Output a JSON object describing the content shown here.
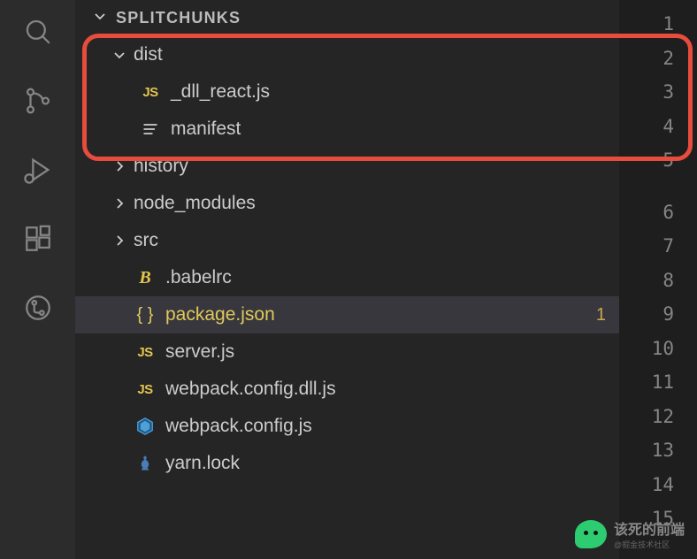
{
  "explorer": {
    "title": "SPLITCHUNKS"
  },
  "tree": {
    "dist": {
      "label": "dist",
      "expanded": true
    },
    "dll_react": {
      "label": "_dll_react.js"
    },
    "manifest": {
      "label": "manifest"
    },
    "history": {
      "label": "history"
    },
    "node_modules": {
      "label": "node_modules"
    },
    "src": {
      "label": "src"
    },
    "babelrc": {
      "label": ".babelrc"
    },
    "package_json": {
      "label": "package.json",
      "badge": "1"
    },
    "server_js": {
      "label": "server.js"
    },
    "webpack_dll": {
      "label": "webpack.config.dll.js"
    },
    "webpack_config": {
      "label": "webpack.config.js"
    },
    "yarn_lock": {
      "label": "yarn.lock"
    }
  },
  "line_numbers": [
    "1",
    "2",
    "3",
    "4",
    "5",
    "6",
    "7",
    "8",
    "9",
    "10",
    "11",
    "12",
    "13",
    "14",
    "15"
  ],
  "watermark": {
    "main": "该死的前端",
    "sub": "@掘金技术社区"
  },
  "colors": {
    "accent_yellow": "#e0c95a",
    "highlight_red": "#e74c3c",
    "bg_activity": "#2c2c2c",
    "bg_sidebar": "#252526",
    "bg_editor": "#1e1e1e"
  }
}
